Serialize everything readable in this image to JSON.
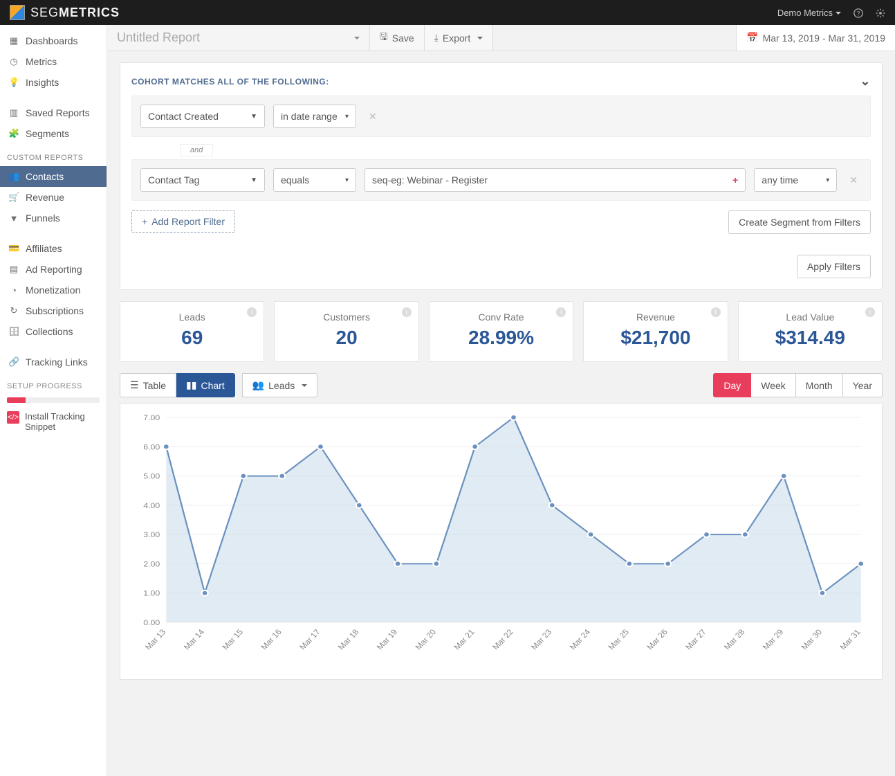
{
  "brand": {
    "seg": "SEG",
    "metrics": "METRICS"
  },
  "topbar": {
    "account": "Demo Metrics"
  },
  "sidebar": {
    "groups": [
      {
        "items": [
          {
            "icon": "dashboard",
            "label": "Dashboards"
          },
          {
            "icon": "gauge",
            "label": "Metrics"
          },
          {
            "icon": "bulb",
            "label": "Insights"
          }
        ]
      },
      {
        "items": [
          {
            "icon": "bar",
            "label": "Saved Reports"
          },
          {
            "icon": "puzzle",
            "label": "Segments"
          }
        ]
      },
      {
        "header": "CUSTOM REPORTS",
        "items": [
          {
            "icon": "users",
            "label": "Contacts",
            "active": true
          },
          {
            "icon": "cart",
            "label": "Revenue"
          },
          {
            "icon": "funnel",
            "label": "Funnels"
          }
        ]
      },
      {
        "items": [
          {
            "icon": "card",
            "label": "Affiliates"
          },
          {
            "icon": "ad",
            "label": "Ad Reporting"
          },
          {
            "icon": "clock",
            "label": "Monetization"
          },
          {
            "icon": "refresh",
            "label": "Subscriptions"
          },
          {
            "icon": "archive",
            "label": "Collections"
          }
        ]
      },
      {
        "items": [
          {
            "icon": "link",
            "label": "Tracking Links"
          }
        ]
      }
    ],
    "progress_header": "SETUP PROGRESS",
    "snippet": "Install Tracking Snippet"
  },
  "report": {
    "title": "Untitled Report",
    "save": "Save",
    "export": "Export",
    "date_range": "Mar 13, 2019 - Mar 31, 2019"
  },
  "cohort": {
    "header": "COHORT MATCHES ALL OF THE FOLLOWING:",
    "rows": [
      {
        "field": "Contact Created",
        "op": "in date range",
        "value": null,
        "time": null
      },
      {
        "field": "Contact Tag",
        "op": "equals",
        "value": "seq-eg: Webinar - Register",
        "time": "any time"
      }
    ],
    "and": "and",
    "add_filter": "Add Report Filter",
    "create_segment": "Create Segment from Filters",
    "apply": "Apply Filters"
  },
  "metrics": [
    {
      "label": "Leads",
      "value": "69"
    },
    {
      "label": "Customers",
      "value": "20"
    },
    {
      "label": "Conv Rate",
      "value": "28.99%"
    },
    {
      "label": "Revenue",
      "value": "$21,700"
    },
    {
      "label": "Lead Value",
      "value": "$314.49"
    }
  ],
  "chart_toolbar": {
    "table": "Table",
    "chart": "Chart",
    "leads": "Leads",
    "ranges": [
      "Day",
      "Week",
      "Month",
      "Year"
    ],
    "active_range": "Day"
  },
  "chart_data": {
    "type": "area",
    "title": "",
    "xlabel": "",
    "ylabel": "",
    "ylim": [
      0,
      7
    ],
    "yticks": [
      "0.00",
      "1.00",
      "2.00",
      "3.00",
      "4.00",
      "5.00",
      "6.00",
      "7.00"
    ],
    "categories": [
      "Mar 13",
      "Mar 14",
      "Mar 15",
      "Mar 16",
      "Mar 17",
      "Mar 18",
      "Mar 19",
      "Mar 20",
      "Mar 21",
      "Mar 22",
      "Mar 23",
      "Mar 24",
      "Mar 25",
      "Mar 26",
      "Mar 27",
      "Mar 28",
      "Mar 29",
      "Mar 30",
      "Mar 31"
    ],
    "series": [
      {
        "name": "Leads",
        "values": [
          6,
          1,
          5,
          5,
          6,
          4,
          2,
          2,
          6,
          7,
          4,
          3,
          2,
          2,
          3,
          3,
          5,
          1,
          2
        ]
      }
    ]
  }
}
